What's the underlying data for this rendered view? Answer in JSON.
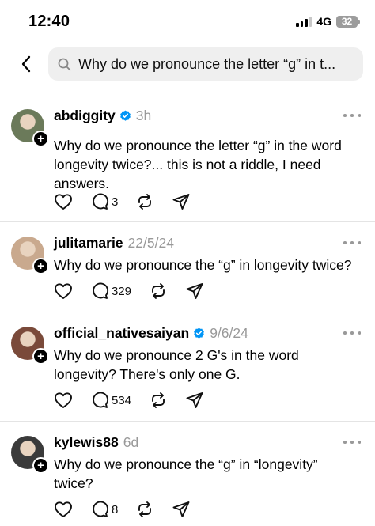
{
  "status_bar": {
    "time": "12:40",
    "network": "4G",
    "battery": "32"
  },
  "search": {
    "query": "Why do we pronounce the letter “g” in t..."
  },
  "posts": [
    {
      "username": "abdiggity",
      "verified": true,
      "time": "3h",
      "text": "Why do we pronounce the letter “g” in the word longevity twice?... this is not a riddle, I need answers.",
      "replies": "3",
      "avatar_color": "#6b7a5a"
    },
    {
      "username": "julitamarie",
      "verified": false,
      "time": "22/5/24",
      "text": "Why do we pronounce the “g” in longevity twice?",
      "replies": "329",
      "avatar_color": "#c9a98e"
    },
    {
      "username": "official_nativesaiyan",
      "verified": true,
      "time": "9/6/24",
      "text": "Why do we pronounce 2 G's in the word longevity? There's only one G.",
      "replies": "534",
      "avatar_color": "#7a4a3a"
    },
    {
      "username": "kylewis88",
      "verified": false,
      "time": "6d",
      "text": "Why do we pronounce the “g” in “longevity” twice?",
      "replies": "8",
      "avatar_color": "#3a3a3a"
    }
  ],
  "colors": {
    "verified_blue": "#0095f6",
    "muted": "#999999"
  },
  "icons": [
    "back-chevron-icon",
    "search-icon",
    "verified-icon",
    "more-icon",
    "heart-icon",
    "comment-icon",
    "repost-icon",
    "share-icon"
  ]
}
